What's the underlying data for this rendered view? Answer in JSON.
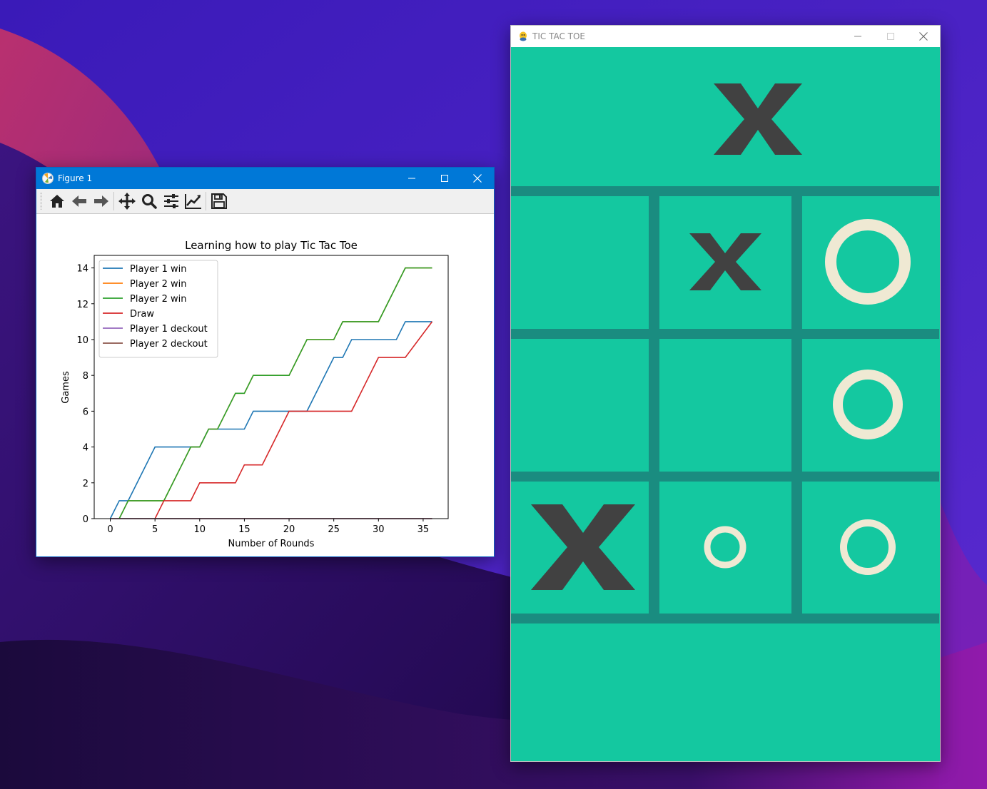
{
  "figure_window": {
    "title": "Figure 1",
    "toolbar": {
      "items": [
        {
          "name": "home-icon",
          "tooltip": "Home"
        },
        {
          "name": "back-arrow-icon",
          "tooltip": "Back"
        },
        {
          "name": "forward-arrow-icon",
          "tooltip": "Forward"
        },
        {
          "name": "pan-icon",
          "tooltip": "Pan"
        },
        {
          "name": "zoom-icon",
          "tooltip": "Zoom"
        },
        {
          "name": "subplots-config-icon",
          "tooltip": "Configure subplots"
        },
        {
          "name": "edit-axis-icon",
          "tooltip": "Edit axis"
        },
        {
          "name": "save-icon",
          "tooltip": "Save"
        }
      ]
    }
  },
  "chart_data": {
    "type": "line",
    "title": "Learning how to play Tic Tac Toe",
    "xlabel": "Number of Rounds",
    "ylabel": "Games",
    "xlim": [
      -1.8,
      37.8
    ],
    "ylim": [
      0,
      14.7
    ],
    "xticks": [
      0,
      5,
      10,
      15,
      20,
      25,
      30,
      35
    ],
    "yticks": [
      0,
      2,
      4,
      6,
      8,
      10,
      12,
      14
    ],
    "legend_position": "upper-left",
    "grid": false,
    "series": [
      {
        "name": "Player 1 win",
        "color": "#1f77b4",
        "points": [
          [
            0,
            0
          ],
          [
            1,
            1
          ],
          [
            2,
            1
          ],
          [
            5,
            4
          ],
          [
            10,
            4
          ],
          [
            11,
            5
          ],
          [
            15,
            5
          ],
          [
            16,
            6
          ],
          [
            17,
            6
          ],
          [
            21,
            6
          ],
          [
            22,
            6
          ],
          [
            25,
            9
          ],
          [
            26,
            9
          ],
          [
            27,
            10
          ],
          [
            32,
            10
          ],
          [
            33,
            11
          ],
          [
            36,
            11
          ]
        ]
      },
      {
        "name": "Player 2 win",
        "color": "#ff7f0e",
        "points": [
          [
            1,
            0
          ],
          [
            2,
            1
          ],
          [
            6,
            1
          ],
          [
            9,
            4
          ],
          [
            10,
            4
          ],
          [
            11,
            5
          ],
          [
            12,
            5
          ],
          [
            14,
            7
          ],
          [
            15,
            7
          ],
          [
            16,
            8
          ],
          [
            20,
            8
          ],
          [
            22,
            10
          ],
          [
            25,
            10
          ],
          [
            26,
            11
          ],
          [
            30,
            11
          ],
          [
            33,
            14
          ],
          [
            36,
            14
          ]
        ]
      },
      {
        "name": "Player 2 win",
        "color": "#2ca02c",
        "points": [
          [
            1,
            0
          ],
          [
            2,
            1
          ],
          [
            6,
            1
          ],
          [
            9,
            4
          ],
          [
            10,
            4
          ],
          [
            11,
            5
          ],
          [
            12,
            5
          ],
          [
            14,
            7
          ],
          [
            15,
            7
          ],
          [
            16,
            8
          ],
          [
            20,
            8
          ],
          [
            22,
            10
          ],
          [
            25,
            10
          ],
          [
            26,
            11
          ],
          [
            30,
            11
          ],
          [
            33,
            14
          ],
          [
            36,
            14
          ]
        ]
      },
      {
        "name": "Draw",
        "color": "#d62728",
        "points": [
          [
            5,
            0
          ],
          [
            6,
            1
          ],
          [
            9,
            1
          ],
          [
            10,
            2
          ],
          [
            14,
            2
          ],
          [
            15,
            3
          ],
          [
            17,
            3
          ],
          [
            20,
            6
          ],
          [
            27,
            6
          ],
          [
            30,
            9
          ],
          [
            33,
            9
          ],
          [
            36,
            11
          ]
        ]
      },
      {
        "name": "Player 1 deckout",
        "color": "#9467bd",
        "points": [
          [
            0,
            0
          ],
          [
            36,
            0
          ]
        ]
      },
      {
        "name": "Player 2 deckout",
        "color": "#8c564b",
        "points": [
          [
            0,
            0
          ],
          [
            36,
            0
          ]
        ]
      }
    ]
  },
  "game_window": {
    "title": "TIC TAC TOE",
    "colors": {
      "background": "#14c8a0",
      "grid": "#1a8c80",
      "x_mark": "#414141",
      "o_mark": "#efe9d3"
    },
    "board": [
      [
        "X",
        "",
        ""
      ],
      [
        "",
        "X",
        "O"
      ],
      [
        "",
        "",
        "O"
      ],
      [
        "X",
        "O",
        "O"
      ]
    ]
  }
}
